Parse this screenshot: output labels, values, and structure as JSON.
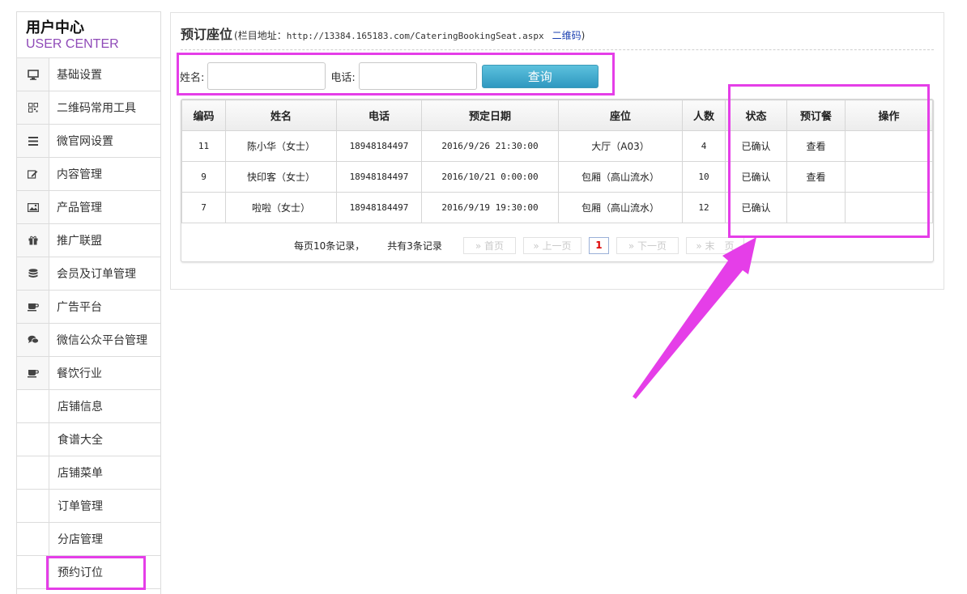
{
  "sidebar": {
    "brand_title": "用户中心",
    "brand_subtitle": "USER CENTER",
    "items": [
      {
        "label": "基础设置",
        "icon": "monitor-icon"
      },
      {
        "label": "二维码常用工具",
        "icon": "qrcode-icon"
      },
      {
        "label": "微官网设置",
        "icon": "menu-lines-icon"
      },
      {
        "label": "内容管理",
        "icon": "edit-icon"
      },
      {
        "label": "产品管理",
        "icon": "image-icon"
      },
      {
        "label": "推广联盟",
        "icon": "gift-icon"
      },
      {
        "label": "会员及订单管理",
        "icon": "database-icon"
      },
      {
        "label": "广告平台",
        "icon": "coffee-icon"
      },
      {
        "label": "微信公众平台管理",
        "icon": "chat-icon"
      },
      {
        "label": "餐饮行业",
        "icon": "coffee-icon"
      }
    ],
    "sub_items": [
      {
        "label": "店铺信息"
      },
      {
        "label": "食谱大全"
      },
      {
        "label": "店铺菜单"
      },
      {
        "label": "订单管理"
      },
      {
        "label": "分店管理"
      },
      {
        "label": "预约订位"
      }
    ]
  },
  "header": {
    "title": "预订座位",
    "url_prefix": "(栏目地址：",
    "url": "http://13384.165183.com/CateringBookingSeat.aspx",
    "qr_link": "二维码",
    "url_suffix": ")"
  },
  "search": {
    "name_label": "姓名:",
    "name_value": "",
    "phone_label": "电话:",
    "phone_value": "",
    "query_button": "查询"
  },
  "table": {
    "headers": [
      "编码",
      "姓名",
      "电话",
      "预定日期",
      "座位",
      "人数",
      "状态",
      "预订餐",
      "操作"
    ],
    "rows": [
      [
        "11",
        "陈小华（女士）",
        "18948184497",
        "2016/9/26 21:30:00",
        "大厅（A03）",
        "4",
        "已确认",
        "查看",
        ""
      ],
      [
        "9",
        "快印客（女士）",
        "18948184497",
        "2016/10/21 0:00:00",
        "包厢（高山流水）",
        "10",
        "已确认",
        "查看",
        ""
      ],
      [
        "7",
        "啦啦（女士）",
        "18948184497",
        "2016/9/19 19:30:00",
        "包厢（高山流水）",
        "12",
        "已确认",
        "",
        ""
      ]
    ]
  },
  "pager": {
    "per_page": "每页10条记录，",
    "total": "共有3条记录",
    "first": "» 首页",
    "prev": "» 上一页",
    "current": "1",
    "next": "» 下一页",
    "last": "» 末　页"
  },
  "colors": {
    "highlight": "#e53ee8",
    "brand_sub": "#8f4ab8",
    "button": "#2f98c0",
    "link": "#1a3fb0"
  }
}
